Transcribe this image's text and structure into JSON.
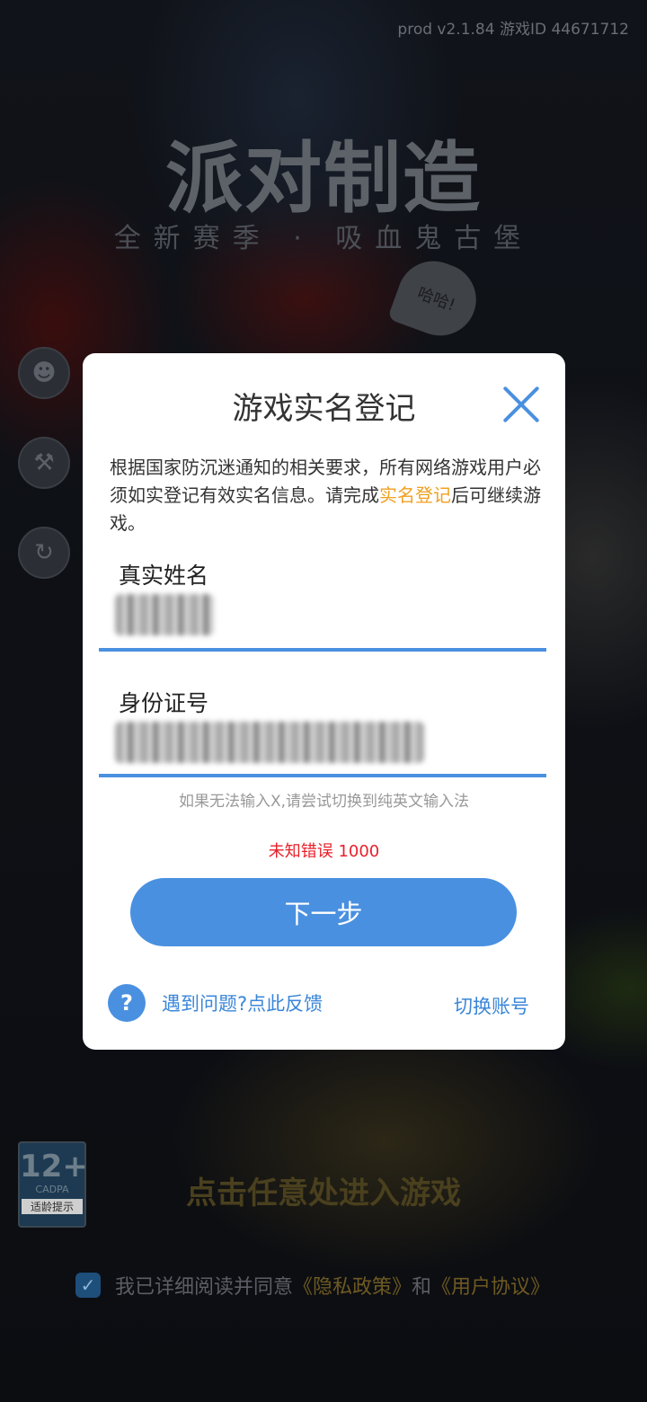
{
  "background": {
    "version": "prod v2.1.84 游戏ID 44671712",
    "logo_title": "派对制造",
    "logo_subtitle": "全新赛季 · 吸血鬼古堡",
    "speech_bubble": "哈哈!",
    "age_badge": {
      "number": "12+",
      "org": "CADPA",
      "label": "适龄提示"
    },
    "enter_prompt": "点击任意处进入游戏",
    "agreement": {
      "checked": true,
      "prefix": "我已详细阅读并同意",
      "privacy_link": "《隐私政策》",
      "and": "和",
      "user_link": "《用户协议》"
    }
  },
  "dialog": {
    "title": "游戏实名登记",
    "notice_before": "根据国家防沉迷通知的相关要求，所有网络游戏用户必须如实登记有效实名信息。请完成",
    "notice_highlight": "实名登记",
    "notice_after": "后可继续游戏。",
    "name_label": "真实姓名",
    "id_label": "身份证号",
    "hint": "如果无法输入X,请尝试切换到纯英文输入法",
    "error": "未知错误 1000",
    "next_button": "下一步",
    "help_icon": "?",
    "help_link": "遇到问题?点此反馈",
    "switch_account": "切换账号"
  },
  "colors": {
    "accent": "#4a90e0",
    "highlight": "#f0a020",
    "error": "#e8202a"
  },
  "icons": [
    "close-icon",
    "help-icon",
    "user-icon",
    "tool-icon",
    "refresh-icon",
    "checkmark-icon"
  ]
}
